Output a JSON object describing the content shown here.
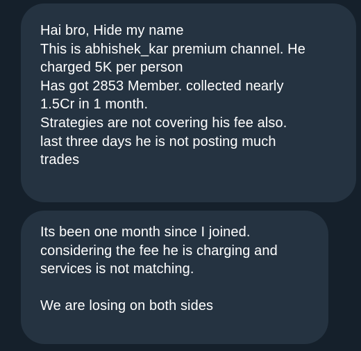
{
  "messages": [
    {
      "lines": [
        "Hai bro, Hide my name",
        "This is abhishek_kar premium channel. He",
        "charged 5K per person",
        "Has got 2853 Member. collected nearly",
        "1.5Cr in 1 month.",
        "Strategies are not covering his fee also.",
        "last three days he is not posting much",
        "trades"
      ]
    },
    {
      "lines": [
        "Its been one month since I joined.",
        "considering the fee he is charging and",
        "services is not matching.",
        "",
        "We are losing on both sides"
      ]
    }
  ],
  "colors": {
    "background": "#15202b",
    "bubble": "#253341",
    "text": "#ffffff"
  }
}
